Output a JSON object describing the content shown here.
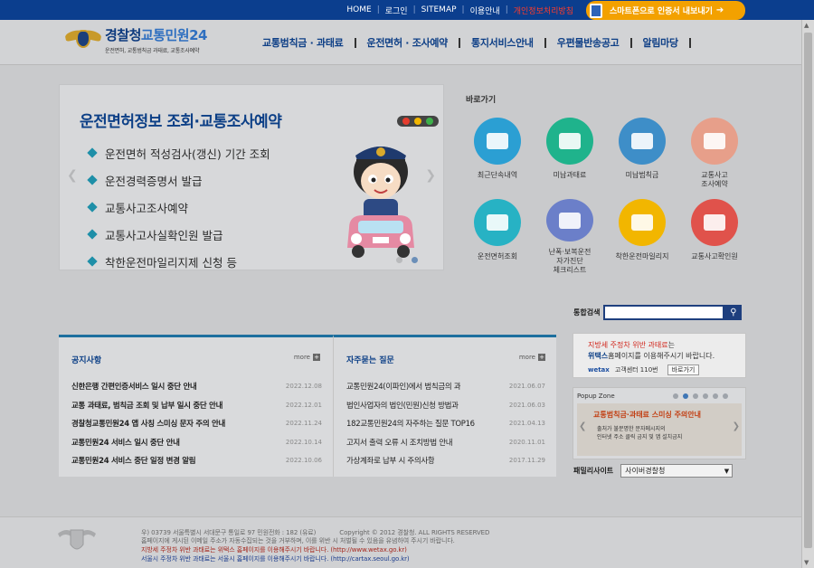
{
  "topbar": {
    "links": [
      "HOME",
      "로그인",
      "SITEMAP",
      "이용안내",
      "개인정보처리방침"
    ],
    "smart_btn": "스마트폰으로 인증서 내보내기"
  },
  "header": {
    "logo_main": "경찰청",
    "logo_blue": "교통민원24",
    "logo_sub": "운전면허, 교통범칙금 과태료, 교통조사예약",
    "nav": [
      "교통범칙금 · 과태료",
      "운전면허 · 조사예약",
      "통지서비스안내",
      "우편물반송공고",
      "알림마당"
    ]
  },
  "banner": {
    "title": "운전면허정보 조회·교통조사예약",
    "items": [
      "운전면허 적성검사(갱신) 기간 조회",
      "운전경력증명서 발급",
      "교통사고조사예약",
      "교통사고사실확인원 발급",
      "착한운전마일리지제 신청 등"
    ]
  },
  "quick": {
    "title": "바로가기",
    "items": [
      {
        "label": "최근단속내역",
        "color": "#2b9fd3"
      },
      {
        "label": "미납과태료",
        "color": "#1fb38c"
      },
      {
        "label": "미납범칙금",
        "color": "#3e8ec8"
      },
      {
        "label": "교통사고\n조사예약",
        "color": "#e79f8a"
      },
      {
        "label": "운전면허조회",
        "color": "#27b2c4"
      },
      {
        "label": "난폭·보복운전\n자가진단\n체크리스트",
        "color": "#6b7fc9"
      },
      {
        "label": "착한운전마일리지",
        "color": "#f2b600"
      },
      {
        "label": "교통사고확인원",
        "color": "#e0524b"
      }
    ]
  },
  "search": {
    "label": "통합검색",
    "placeholder": ""
  },
  "ad": {
    "line1_red": "지방세 주정차 위반 과태료",
    "line1_rest": "는",
    "line2_bold": "위택스",
    "line2_rest": "홈페이지를 이용해주시기 바랍니다.",
    "brand": "wetax",
    "phone": "고객센터 110번",
    "go": "바로가기"
  },
  "popup": {
    "title": "Popup Zone",
    "headline": "교통범칙금·과태료 스미싱 주의안내",
    "body": "출처가 불분명한 문자메시지의\n인터넷 주소 클릭 금지 및 앱 설치금지"
  },
  "family": {
    "label": "패밀리사이트",
    "value": "사이버경찰청"
  },
  "notice": {
    "title": "공지사항",
    "more": "more",
    "rows": [
      {
        "text": "신한은행 간편인증서비스 일시 중단 안내",
        "date": "2022.12.08"
      },
      {
        "text": "교통 과태료, 범칙금 조회 및 납부 일시 중단 안내",
        "date": "2022.12.01"
      },
      {
        "text": "경찰청교통민원24 앱 사칭 스미싱 문자 주의 안내",
        "date": "2022.11.24"
      },
      {
        "text": "교통민원24 서비스 일시 중단 안내",
        "date": "2022.10.14"
      },
      {
        "text": "교통민원24 서비스 중단 일정 변경 알림",
        "date": "2022.10.06"
      }
    ]
  },
  "faq": {
    "title": "자주묻는 질문",
    "more": "more",
    "rows": [
      {
        "text": "교통민원24(이파인)에서 범칙금의 과",
        "date": "2021.06.07"
      },
      {
        "text": "법인사업자의 법인(민원)신청 방법과",
        "date": "2021.06.03"
      },
      {
        "text": "182교통민원24의 자주하는 질문 TOP16",
        "date": "2021.04.13"
      },
      {
        "text": "고지서 출력 오류 시 조치방법 안내",
        "date": "2020.11.01"
      },
      {
        "text": "가상계좌로 납부 시 주의사항",
        "date": "2017.11.29"
      }
    ]
  },
  "footer": {
    "address": "우) 03739 서울특별시 서대문구 통일로 97  민원전화 : 182 (유료)",
    "copyright": "Copyright © 2012 경찰청. ALL RIGHTS RESERVED",
    "notice": "홈페이지에 게시된 이메일 주소가 자동수집되는 것을 거부하며, 이를 위반 시 처벌될 수 있음을 유념하여 주시기 바랍니다.",
    "wetax_line": "지방세 주정차 위반 과태료는 위택스 홈페이지를 이용해주시기 바랍니다. (http://www.wetax.go.kr)",
    "seoul_line": "서울시 주정차 위반 과태료는 서울시 홈페이지를 이용해주시기 바랍니다. (http://cartax.seoul.go.kr)"
  }
}
